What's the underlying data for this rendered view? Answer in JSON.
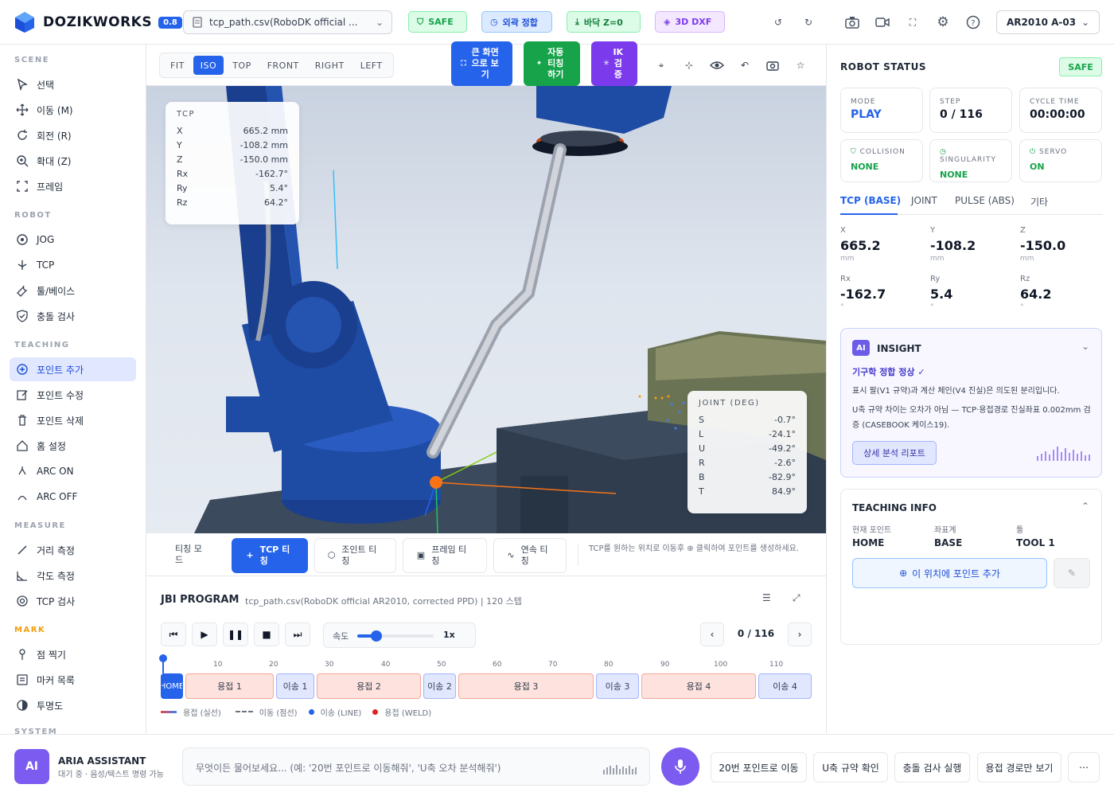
{
  "app": {
    "name": "DOZIKWORKS",
    "version": "0.8"
  },
  "topbar": {
    "file_name": "tcp_path.csv(RoboDK official ...",
    "badges": {
      "safe": "SAFE",
      "reach": "외곽 정합",
      "floor": "바닥 Z=0",
      "dxf": "3D DXF"
    },
    "robot_model": "AR2010 A-03"
  },
  "sidebar": {
    "scene_title": "SCENE",
    "scene": [
      "선택",
      "이동 (M)",
      "회전 (R)",
      "확대 (Z)",
      "프레임"
    ],
    "robot_title": "ROBOT",
    "robot": [
      "JOG",
      "TCP",
      "툴/베이스",
      "충돌 검사"
    ],
    "teaching_title": "TEACHING",
    "teaching": [
      "포인트 추가",
      "포인트 수정",
      "포인트 삭제",
      "홈 설정",
      "ARC ON",
      "ARC OFF"
    ],
    "measure_title": "MEASURE",
    "measure": [
      "거리 측정",
      "각도 측정",
      "TCP 검사"
    ],
    "mark_title": "MARK",
    "mark": [
      "점 찍기",
      "마커 목록",
      "투명도"
    ],
    "system_title": "SYSTEM"
  },
  "viewport": {
    "view_tabs": [
      "FIT",
      "ISO",
      "TOP",
      "FRONT",
      "RIGHT",
      "LEFT"
    ],
    "active_view": "ISO",
    "big_buttons": {
      "fullscreen": "큰 화면으로 보기",
      "auto_teach": "자동 티칭 하기",
      "ik_check": "IK 검증"
    }
  },
  "tcp_overlay": {
    "title": "TCP",
    "rows": [
      {
        "k": "X",
        "v": "665.2 mm"
      },
      {
        "k": "Y",
        "v": "-108.2 mm"
      },
      {
        "k": "Z",
        "v": "-150.0 mm"
      },
      {
        "k": "Rx",
        "v": "-162.7°"
      },
      {
        "k": "Ry",
        "v": "5.4°"
      },
      {
        "k": "Rz",
        "v": "64.2°"
      }
    ]
  },
  "joint_overlay": {
    "title": "JOINT (DEG)",
    "rows": [
      {
        "k": "S",
        "v": "-0.7°"
      },
      {
        "k": "L",
        "v": "-24.1°"
      },
      {
        "k": "U",
        "v": "-49.2°"
      },
      {
        "k": "R",
        "v": "-2.6°"
      },
      {
        "k": "B",
        "v": "-82.9°"
      },
      {
        "k": "T",
        "v": "84.9°"
      }
    ]
  },
  "teach_modes": {
    "mode_label": "티칭 모드",
    "tcp": "TCP 티칭",
    "joint": "조인트 티칭",
    "frame": "프레임 티칭",
    "continuous": "연속 티칭",
    "hint": "TCP를 원하는 위치로 이동후 ⊕ 클릭하여 포인트를 생성하세요."
  },
  "jbi": {
    "title": "JBI PROGRAM",
    "subtitle": "tcp_path.csv(RoboDK official AR2010, corrected PPD) | 120 스텝",
    "speed_label": "속도",
    "speed_value": "1x",
    "speed_fraction": 0.25,
    "step_display": "0 / 116",
    "ticks": [
      "10",
      "20",
      "30",
      "40",
      "50",
      "60",
      "70",
      "80",
      "90",
      "100",
      "110"
    ],
    "segments": [
      "HOME",
      "용접 1",
      "이송 1",
      "용접 2",
      "이송 2",
      "용접 3",
      "이송 3",
      "용접 4",
      "이송 4"
    ],
    "legend": [
      "용접 (실선)",
      "이동 (점선)",
      "이송 (LINE)",
      "용접 (WELD)"
    ]
  },
  "status": {
    "title": "ROBOT STATUS",
    "safe": "SAFE",
    "mode_label": "MODE",
    "mode": "PLAY",
    "step_label": "STEP",
    "step": "0 / 116",
    "cycle_label": "CYCLE TIME",
    "cycle": "00:00:00",
    "collision_label": "COLLISION",
    "collision": "NONE",
    "singularity_label": "SINGULARITY",
    "singularity": "NONE",
    "servo_label": "SERVO",
    "servo": "ON"
  },
  "coord_tabs": [
    "TCP (BASE)",
    "JOINT",
    "PULSE (ABS)",
    "기타"
  ],
  "coords": [
    {
      "label": "X",
      "value": "665.2",
      "unit": "mm"
    },
    {
      "label": "Y",
      "value": "-108.2",
      "unit": "mm"
    },
    {
      "label": "Z",
      "value": "-150.0",
      "unit": "mm"
    },
    {
      "label": "Rx",
      "value": "-162.7",
      "unit": "°"
    },
    {
      "label": "Ry",
      "value": "5.4",
      "unit": "°"
    },
    {
      "label": "Rz",
      "value": "64.2",
      "unit": "°"
    }
  ],
  "insight": {
    "badge": "AI",
    "title": "INSIGHT",
    "headline": "기구학 정합 정상 ✓",
    "p1": "표시 팔(V1 규약)과 계산 체인(V4 진실)은 의도된 분리입니다.",
    "p2": "U축 규약 차이는 오차가 아님 — TCP·용접경로 진실좌표 0.002mm 검증 (CASEBOOK 케이스19).",
    "report_button": "상세 분석 리포트"
  },
  "teaching_info": {
    "title": "TEACHING INFO",
    "current_point_label": "현재 포인트",
    "current_point": "HOME",
    "frame_label": "좌표계",
    "frame": "BASE",
    "tool_label": "툴",
    "tool": "TOOL 1",
    "add_button": "이 위치에 포인트 추가"
  },
  "assistant": {
    "badge": "AI",
    "name": "ARIA ASSISTANT",
    "status": "대기 중 · 음성/텍스트 명령 가능",
    "placeholder": "무엇이든 물어보세요... (예: '20번 포인트로 이동해줘', 'U축 오차 분석해줘')",
    "quick": [
      "20번 포인트로 이동",
      "U축 규약 확인",
      "충돌 검사 실행",
      "용접 경로만 보기"
    ]
  },
  "colors": {
    "accent": "#2563eb",
    "safe": "#16a34a",
    "ai_purple": "#7c3aed",
    "teach_green": "#16a34a",
    "mark": "#f59e0b",
    "robot_blue": "#1e4ba3"
  }
}
